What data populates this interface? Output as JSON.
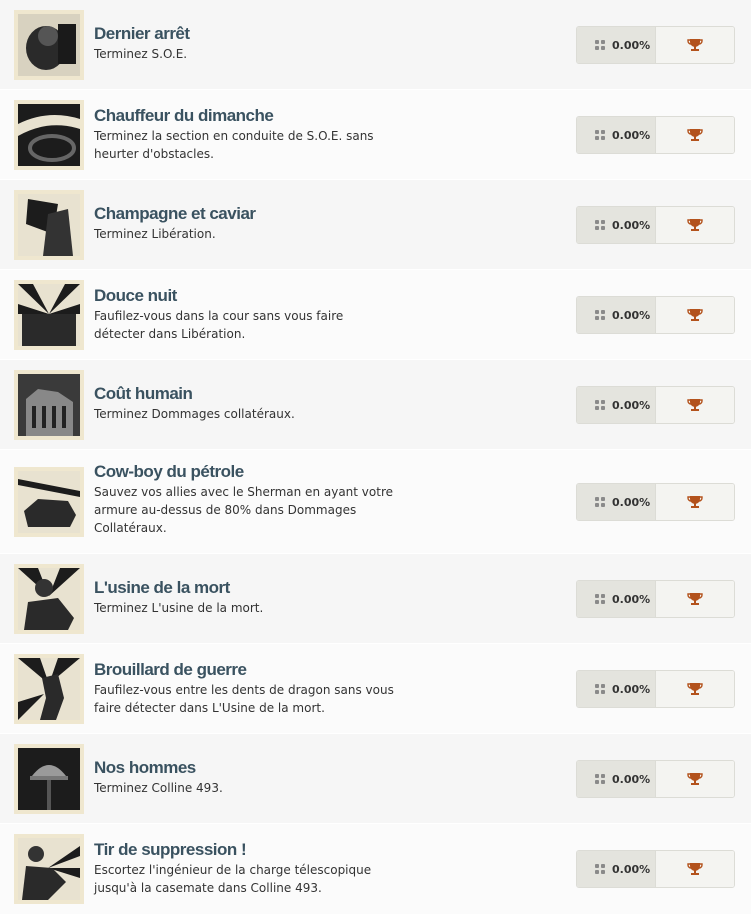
{
  "achievements": [
    {
      "title": "Dernier arrêt",
      "description": "Terminez S.O.E.",
      "percent": "0.00%",
      "icon": "soldier-portrait-icon",
      "trophy": "bronze"
    },
    {
      "title": "Chauffeur du dimanche",
      "description": "Terminez la section en conduite de S.O.E. sans heurter d'obstacles.",
      "percent": "0.00%",
      "icon": "steering-wheel-icon",
      "trophy": "bronze"
    },
    {
      "title": "Champagne et caviar",
      "description": "Terminez Libération.",
      "percent": "0.00%",
      "icon": "flag-soldiers-icon",
      "trophy": "bronze"
    },
    {
      "title": "Douce nuit",
      "description": "Faufilez-vous dans la cour sans vous faire détecter dans Libération.",
      "percent": "0.00%",
      "icon": "building-rays-icon",
      "trophy": "bronze"
    },
    {
      "title": "Coût humain",
      "description": "Terminez Dommages collatéraux.",
      "percent": "0.00%",
      "icon": "ruined-building-icon",
      "trophy": "bronze"
    },
    {
      "title": "Cow-boy du pétrole",
      "description": "Sauvez vos allies avec le Sherman en ayant votre armure au-dessus de 80% dans Dommages Collatéraux.",
      "percent": "0.00%",
      "icon": "tank-icon",
      "trophy": "bronze"
    },
    {
      "title": "L'usine de la mort",
      "description": "Terminez L'usine de la mort.",
      "percent": "0.00%",
      "icon": "gas-mask-soldier-icon",
      "trophy": "bronze"
    },
    {
      "title": "Brouillard de guerre",
      "description": "Faufilez-vous entre les dents de dragon sans vous faire détecter dans L'Usine de la mort.",
      "percent": "0.00%",
      "icon": "sneaking-soldier-icon",
      "trophy": "bronze"
    },
    {
      "title": "Nos hommes",
      "description": "Terminez Colline 493.",
      "percent": "0.00%",
      "icon": "helmet-rifle-icon",
      "trophy": "bronze"
    },
    {
      "title": "Tir de suppression !",
      "description": "Escortez l'ingénieur de la charge télescopique jusqu'à la casemate dans Colline 493.",
      "percent": "0.00%",
      "icon": "firing-soldier-icon",
      "trophy": "bronze"
    }
  ],
  "colors": {
    "title": "#3a5260",
    "trophy": "#b3521c",
    "thumb_border": "#efe7cf"
  }
}
